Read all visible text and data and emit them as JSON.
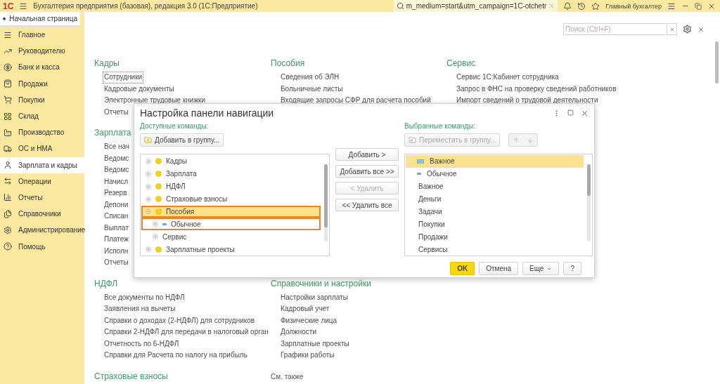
{
  "title_bar": {
    "logo": "1С",
    "title": "Бухгалтерия предприятия (базовая), редакция 3.0  (1С:Предприятие)",
    "search_value": "m_medium=start&utm_campaign=1C-otchetr",
    "user": "Главный бухгалтер"
  },
  "sidebar": {
    "home_tab": {
      "label": "Начальная страница",
      "selected": true
    },
    "items": [
      {
        "label": "Главное",
        "selected": false
      },
      {
        "label": "Руководителю",
        "selected": false
      },
      {
        "label": "Банк и касса",
        "selected": false
      },
      {
        "label": "Продажи",
        "selected": false
      },
      {
        "label": "Покупки",
        "selected": false
      },
      {
        "label": "Склад",
        "selected": false
      },
      {
        "label": "Производство",
        "selected": false
      },
      {
        "label": "ОС и НМА",
        "selected": false
      },
      {
        "label": "Зарплата и кадры",
        "selected": true
      },
      {
        "label": "Операции",
        "selected": false
      },
      {
        "label": "Отчеты",
        "selected": false
      },
      {
        "label": "Справочники",
        "selected": false
      },
      {
        "label": "Администрирование",
        "selected": false
      },
      {
        "label": "Помощь",
        "selected": false
      }
    ]
  },
  "content": {
    "search": {
      "placeholder": "Поиск (Ctrl+F)"
    },
    "rows": [
      [
        {
          "kind": "group",
          "title": "Кадры",
          "items": [
            {
              "label": "Сотрудники",
              "focused": true
            },
            {
              "label": "Кадровые документы",
              "focused": false
            },
            {
              "label": "Электронные трудовые книжки",
              "focused": false
            },
            {
              "label": "Отчеты",
              "focused": false
            }
          ]
        },
        {
          "kind": "group",
          "title": "Пособия",
          "items": [
            {
              "label": "Сведения об ЭЛН",
              "focused": false
            },
            {
              "label": "Больничные листы",
              "focused": false
            },
            {
              "label": "Входящие запросы СФР для расчета пособий",
              "focused": false
            }
          ]
        },
        {
          "kind": "group",
          "title": "Сервис",
          "items": [
            {
              "label": "Сервис 1С:Кабинет сотрудника",
              "focused": false
            },
            {
              "label": "Запрос в ФНС на проверку сведений работников",
              "focused": false
            },
            {
              "label": "Импорт сведений о трудовой деятельности",
              "focused": false
            }
          ]
        }
      ],
      [
        {
          "kind": "group",
          "title": "Зарплата",
          "items": [
            {
              "label": "Все нач",
              "focused": false
            },
            {
              "label": "Ведомс",
              "focused": false
            },
            {
              "label": "Ведомс",
              "focused": false
            },
            {
              "label": "Начисл",
              "focused": false
            },
            {
              "label": "Резерв",
              "focused": false
            },
            {
              "label": "Депони",
              "focused": false
            },
            {
              "label": "Списан",
              "focused": false
            },
            {
              "label": "Выплат",
              "focused": false
            },
            {
              "label": "Платеж",
              "focused": false
            },
            {
              "label": "Исполн",
              "focused": false
            },
            {
              "label": "Отчеты",
              "focused": false
            }
          ]
        }
      ],
      [
        {
          "kind": "group",
          "title": "НДФЛ",
          "items": [
            {
              "label": "Все документы по НДФЛ",
              "focused": false
            },
            {
              "label": "Заявления на вычеты",
              "focused": false
            },
            {
              "label": "Справки о доходах (2-НДФЛ) для сотрудников",
              "focused": false
            },
            {
              "label": "Справки 2-НДФЛ для передачи в налоговый орган",
              "focused": false
            },
            {
              "label": "Отчетность по 6-НДФЛ",
              "focused": false
            },
            {
              "label": "Справки для Расчета по налогу на прибыль",
              "focused": false
            }
          ]
        },
        {
          "kind": "group",
          "title": "Справочники и настройки",
          "items": [
            {
              "label": "Настройки зарплаты",
              "focused": false
            },
            {
              "label": "Кадровый учет",
              "focused": false
            },
            {
              "label": "Физические лица",
              "focused": false
            },
            {
              "label": "Должности",
              "focused": false
            },
            {
              "label": "Зарплатные проекты",
              "focused": false
            },
            {
              "label": "Графики работы",
              "focused": false
            }
          ]
        }
      ],
      [
        {
          "kind": "group",
          "title": "Страховые взносы"
        },
        {
          "kind": "see_also",
          "title": "См. также"
        }
      ]
    ]
  },
  "dialog": {
    "title": "Настройка панели навигации",
    "available": {
      "label": "Доступные команды:",
      "add_to_group": "Добавить в группу...",
      "tree": [
        {
          "label": "Кадры",
          "kind": "group",
          "expanded": false,
          "selected": false,
          "highlighted": false
        },
        {
          "label": "Зарплата",
          "kind": "group",
          "expanded": false,
          "selected": false,
          "highlighted": false
        },
        {
          "label": "НДФЛ",
          "kind": "group",
          "expanded": false,
          "selected": false,
          "highlighted": false
        },
        {
          "label": "Страховые взносы",
          "kind": "group",
          "expanded": false,
          "selected": false,
          "highlighted": false
        },
        {
          "label": "Пособия",
          "kind": "group",
          "expanded": true,
          "selected": true,
          "highlighted": true,
          "children": [
            {
              "label": "Обычное",
              "kind": "normal",
              "expanded": false,
              "selected": false,
              "highlighted": true
            },
            {
              "label": "Сервис",
              "kind": "plain",
              "expanded": false,
              "selected": false,
              "highlighted": false
            }
          ]
        },
        {
          "label": "Зарплатные проекты",
          "kind": "group",
          "expanded": false,
          "selected": false,
          "highlighted": false
        }
      ]
    },
    "actions": [
      {
        "label": "Добавить >",
        "disabled": false
      },
      {
        "label": "Добавить все >>",
        "disabled": false
      },
      {
        "label": "< Удалить",
        "disabled": true
      },
      {
        "label": "<< Удалить все",
        "disabled": false
      }
    ],
    "chosen": {
      "label": "Выбранные команды:",
      "move_to_group": {
        "label": "Переместить в группу...",
        "disabled": true
      },
      "list": [
        {
          "label": "Важное",
          "kind": "important",
          "selected": true
        },
        {
          "label": "Обычное",
          "kind": "normal",
          "selected": false
        },
        {
          "label": "Важное",
          "kind": "plain",
          "selected": false
        },
        {
          "label": "Деньги",
          "kind": "plain",
          "selected": false
        },
        {
          "label": "Задачи",
          "kind": "plain",
          "selected": false
        },
        {
          "label": "Покупки",
          "kind": "plain",
          "selected": false
        },
        {
          "label": "Продажи",
          "kind": "plain",
          "selected": false
        },
        {
          "label": "Сервисы",
          "kind": "plain",
          "selected": false
        }
      ]
    },
    "buttons": [
      {
        "label": "OK",
        "kind": "primary"
      },
      {
        "label": "Отмена",
        "kind": "normal"
      },
      {
        "label": "Еще",
        "kind": "menu"
      },
      {
        "label": "?",
        "kind": "normal"
      }
    ]
  }
}
